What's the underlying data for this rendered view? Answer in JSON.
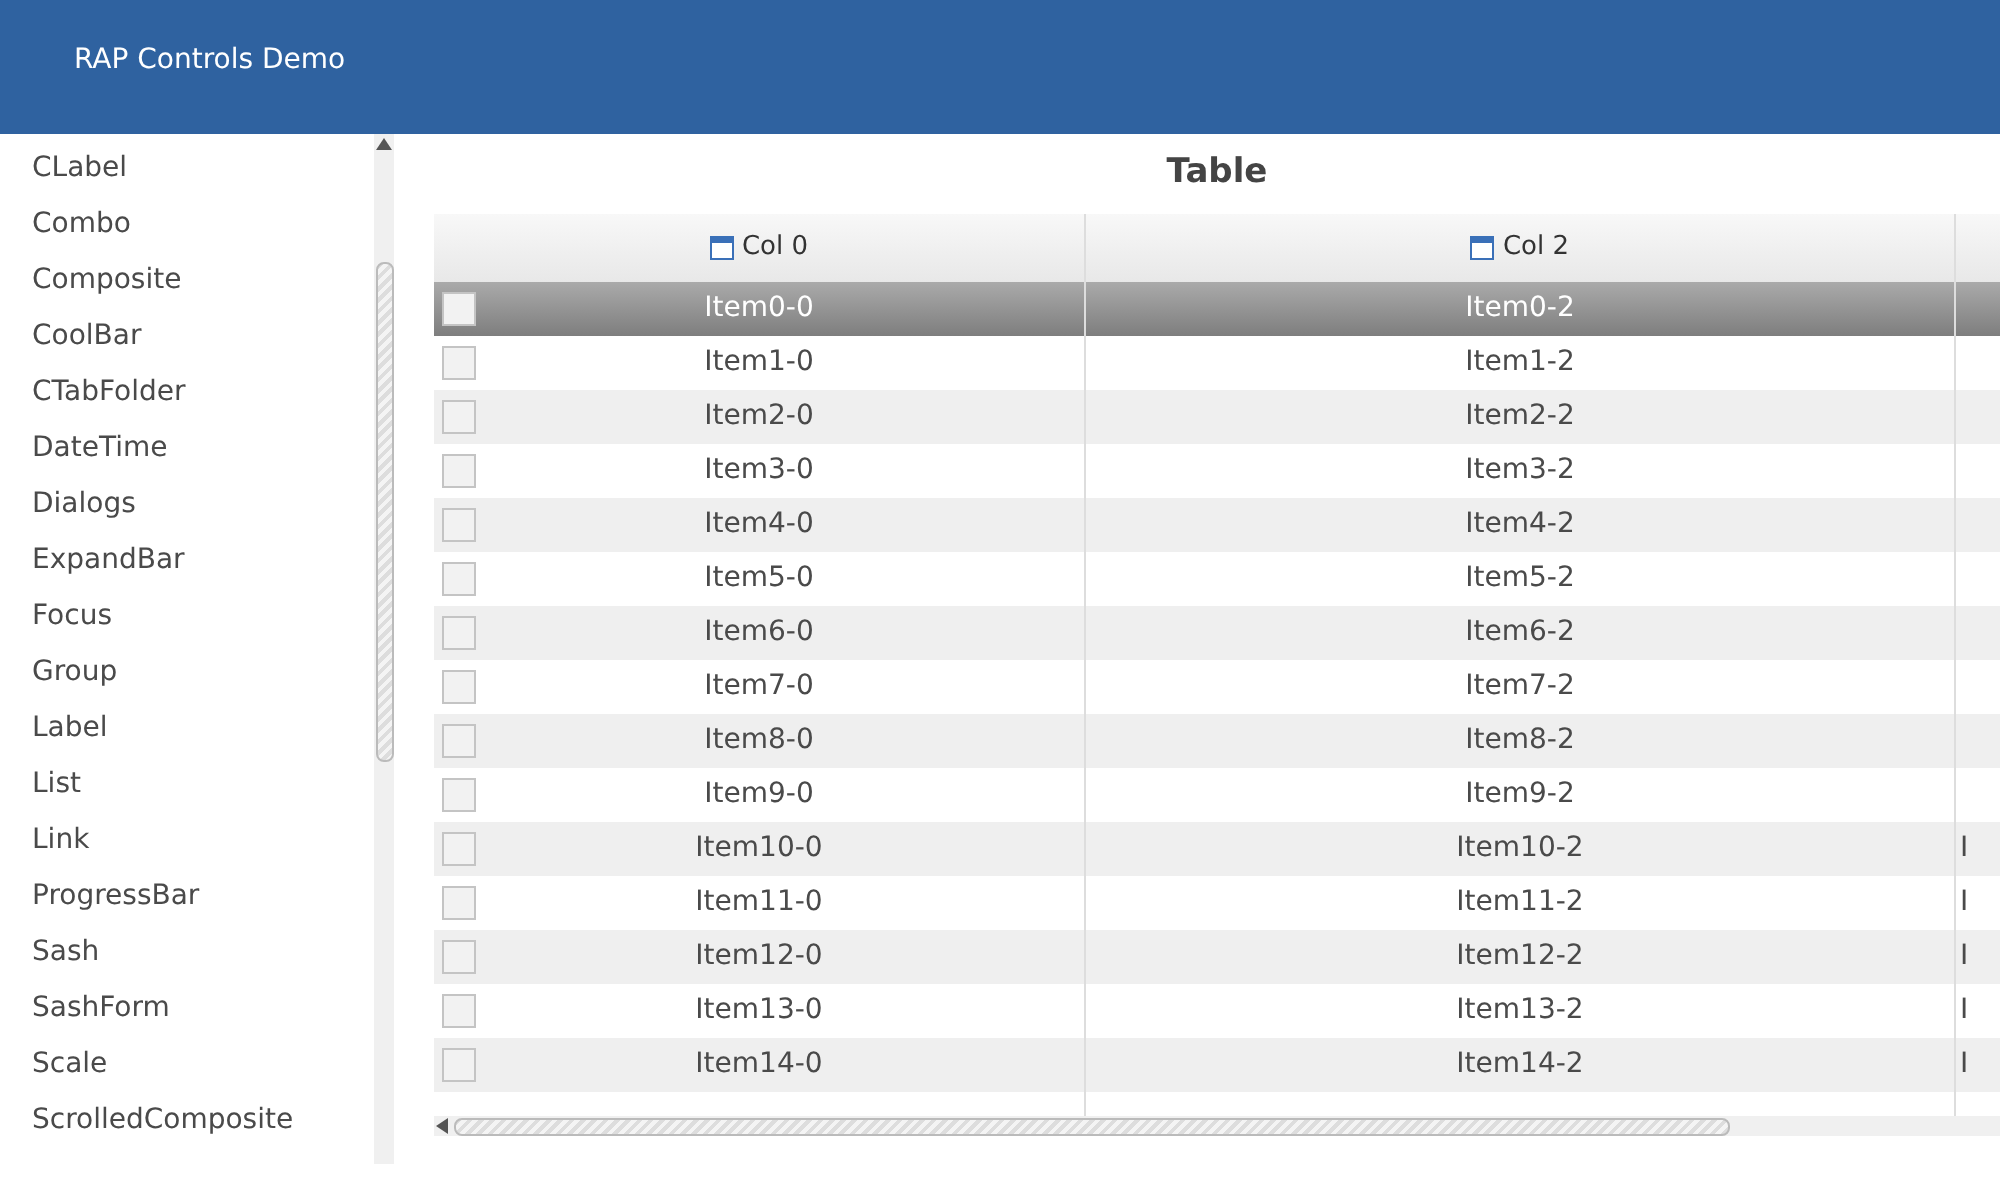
{
  "header": {
    "title": "RAP Controls Demo"
  },
  "sidebar": {
    "items": [
      {
        "label": "CLabel",
        "selected": false
      },
      {
        "label": "Combo",
        "selected": false
      },
      {
        "label": "Composite",
        "selected": false
      },
      {
        "label": "CoolBar",
        "selected": false
      },
      {
        "label": "CTabFolder",
        "selected": false
      },
      {
        "label": "DateTime",
        "selected": false
      },
      {
        "label": "Dialogs",
        "selected": false
      },
      {
        "label": "ExpandBar",
        "selected": false
      },
      {
        "label": "Focus",
        "selected": false
      },
      {
        "label": "Group",
        "selected": false
      },
      {
        "label": "Label",
        "selected": false
      },
      {
        "label": "List",
        "selected": false
      },
      {
        "label": "Link",
        "selected": false
      },
      {
        "label": "ProgressBar",
        "selected": false
      },
      {
        "label": "Sash",
        "selected": false
      },
      {
        "label": "SashForm",
        "selected": false
      },
      {
        "label": "Scale",
        "selected": false
      },
      {
        "label": "ScrolledComposite",
        "selected": false
      }
    ]
  },
  "page": {
    "title": "Table"
  },
  "table": {
    "columns": [
      "Col 0",
      "Col 2"
    ],
    "rows": [
      {
        "cells": [
          "Item0-0",
          "Item0-2"
        ],
        "checked": false,
        "selected": true
      },
      {
        "cells": [
          "Item1-0",
          "Item1-2"
        ],
        "checked": false,
        "selected": false
      },
      {
        "cells": [
          "Item2-0",
          "Item2-2"
        ],
        "checked": false,
        "selected": false
      },
      {
        "cells": [
          "Item3-0",
          "Item3-2"
        ],
        "checked": false,
        "selected": false
      },
      {
        "cells": [
          "Item4-0",
          "Item4-2"
        ],
        "checked": false,
        "selected": false
      },
      {
        "cells": [
          "Item5-0",
          "Item5-2"
        ],
        "checked": false,
        "selected": false
      },
      {
        "cells": [
          "Item6-0",
          "Item6-2"
        ],
        "checked": false,
        "selected": false
      },
      {
        "cells": [
          "Item7-0",
          "Item7-2"
        ],
        "checked": false,
        "selected": false
      },
      {
        "cells": [
          "Item8-0",
          "Item8-2"
        ],
        "checked": false,
        "selected": false
      },
      {
        "cells": [
          "Item9-0",
          "Item9-2"
        ],
        "checked": false,
        "selected": false
      },
      {
        "cells": [
          "Item10-0",
          "Item10-2",
          "I"
        ],
        "checked": false,
        "selected": false
      },
      {
        "cells": [
          "Item11-0",
          "Item11-2",
          "I"
        ],
        "checked": false,
        "selected": false
      },
      {
        "cells": [
          "Item12-0",
          "Item12-2",
          "I"
        ],
        "checked": false,
        "selected": false
      },
      {
        "cells": [
          "Item13-0",
          "Item13-2",
          "I"
        ],
        "checked": false,
        "selected": false
      },
      {
        "cells": [
          "Item14-0",
          "Item14-2",
          "I"
        ],
        "checked": false,
        "selected": false
      }
    ]
  }
}
